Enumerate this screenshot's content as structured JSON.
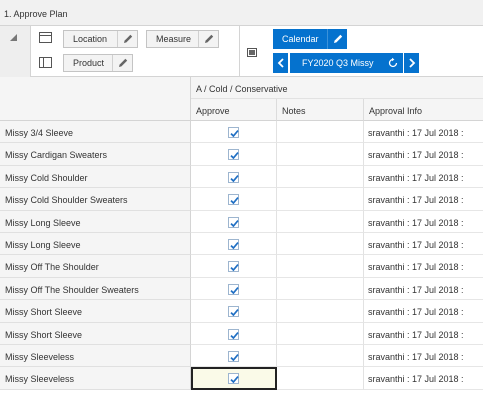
{
  "window": {
    "title": "1. Approve Plan"
  },
  "pivot": {
    "row_tiles": [
      {
        "label": "Location",
        "icon": "pencil-icon"
      },
      {
        "label": "Measure",
        "icon": "pencil-icon"
      },
      {
        "label": "Product",
        "icon": "pencil-icon"
      }
    ],
    "column_tile": {
      "label": "Calendar",
      "icon": "pencil-icon"
    },
    "page_selector": {
      "value": "FY2020 Q3 Missy",
      "prev_icon": "chevron-left-icon",
      "next_icon": "chevron-right-icon",
      "reset_icon": "cycle-icon"
    }
  },
  "grid": {
    "group_header": "A / Cold / Conservative",
    "columns": [
      "Approve",
      "Notes",
      "Approval Info"
    ],
    "rows": [
      {
        "label": "Missy 3/4 Sleeve",
        "approve": true,
        "notes": "",
        "info": "sravanthi : 17 Jul 2018 :"
      },
      {
        "label": "Missy Cardigan Sweaters",
        "approve": true,
        "notes": "",
        "info": "sravanthi : 17 Jul 2018 :"
      },
      {
        "label": "Missy Cold Shoulder",
        "approve": true,
        "notes": "",
        "info": "sravanthi : 17 Jul 2018 :"
      },
      {
        "label": "Missy Cold Shoulder Sweaters",
        "approve": true,
        "notes": "",
        "info": "sravanthi : 17 Jul 2018 :"
      },
      {
        "label": "Missy Long Sleeve",
        "approve": true,
        "notes": "",
        "info": "sravanthi : 17 Jul 2018 :"
      },
      {
        "label": "Missy Long Sleeve",
        "approve": true,
        "notes": "",
        "info": "sravanthi : 17 Jul 2018 :"
      },
      {
        "label": "Missy Off The Shoulder",
        "approve": true,
        "notes": "",
        "info": "sravanthi : 17 Jul 2018 :"
      },
      {
        "label": "Missy Off The Shoulder Sweaters",
        "approve": true,
        "notes": "",
        "info": "sravanthi : 17 Jul 2018 :"
      },
      {
        "label": "Missy Short Sleeve",
        "approve": true,
        "notes": "",
        "info": "sravanthi : 17 Jul 2018 :"
      },
      {
        "label": "Missy Short Sleeve",
        "approve": true,
        "notes": "",
        "info": "sravanthi : 17 Jul 2018 :"
      },
      {
        "label": "Missy Sleeveless",
        "approve": true,
        "notes": "",
        "info": "sravanthi : 17 Jul 2018 :"
      },
      {
        "label": "Missy Sleeveless",
        "approve": true,
        "notes": "",
        "info": "sravanthi : 17 Jul 2018 :",
        "selected": true
      }
    ]
  },
  "colors": {
    "accent": "#0572ce",
    "check": "#1f6fc4",
    "header_bg": "#f5f5f5"
  }
}
